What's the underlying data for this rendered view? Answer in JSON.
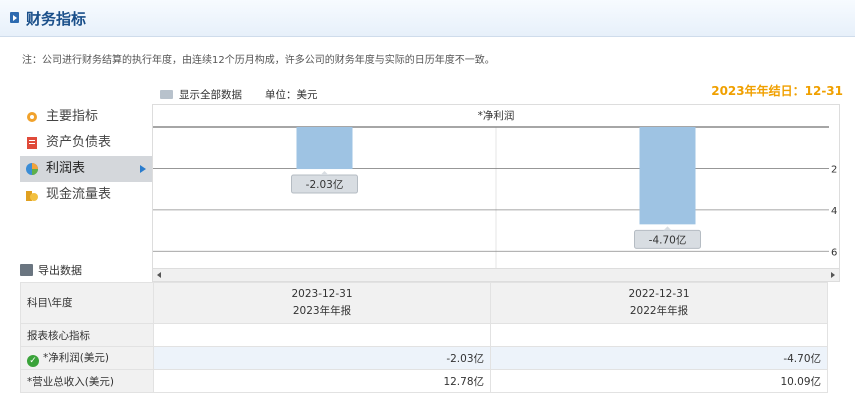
{
  "header": {
    "title": "财务指标"
  },
  "note": "注：公司进行财务结算的执行年度，由连续12个历月构成，许多公司的财务年度与实际的日历年度不一致。",
  "year_end": "2023年年结日：12-31",
  "toolbar": {
    "show_all": "显示全部数据",
    "unit": "单位：美元"
  },
  "sidebar": {
    "items": [
      {
        "label": "主要指标"
      },
      {
        "label": "资产负债表"
      },
      {
        "label": "利润表"
      },
      {
        "label": "现金流量表"
      }
    ]
  },
  "export_label": "导出数据",
  "chart_data": {
    "type": "bar",
    "title": "*净利润",
    "categories": [
      "2023-12-31",
      "2022-12-31"
    ],
    "values": [
      -2.03,
      -4.7
    ],
    "value_labels": [
      "-2.03亿",
      "-4.70亿"
    ],
    "ylim": [
      -7,
      0
    ],
    "y_ticks": [
      2,
      4,
      6
    ],
    "color": "#9ec3e3"
  },
  "table": {
    "header": {
      "col0": "科目\\年度",
      "col1_line1": "2023-12-31",
      "col1_line2": "2023年年报",
      "col2_line1": "2022-12-31",
      "col2_line2": "2022年年报"
    },
    "section": "报表核心指标",
    "rows": [
      {
        "label": "*净利润(美元)",
        "v1": "-2.03亿",
        "v2": "-4.70亿"
      },
      {
        "label": "*营业总收入(美元)",
        "v1": "12.78亿",
        "v2": "10.09亿"
      }
    ]
  }
}
